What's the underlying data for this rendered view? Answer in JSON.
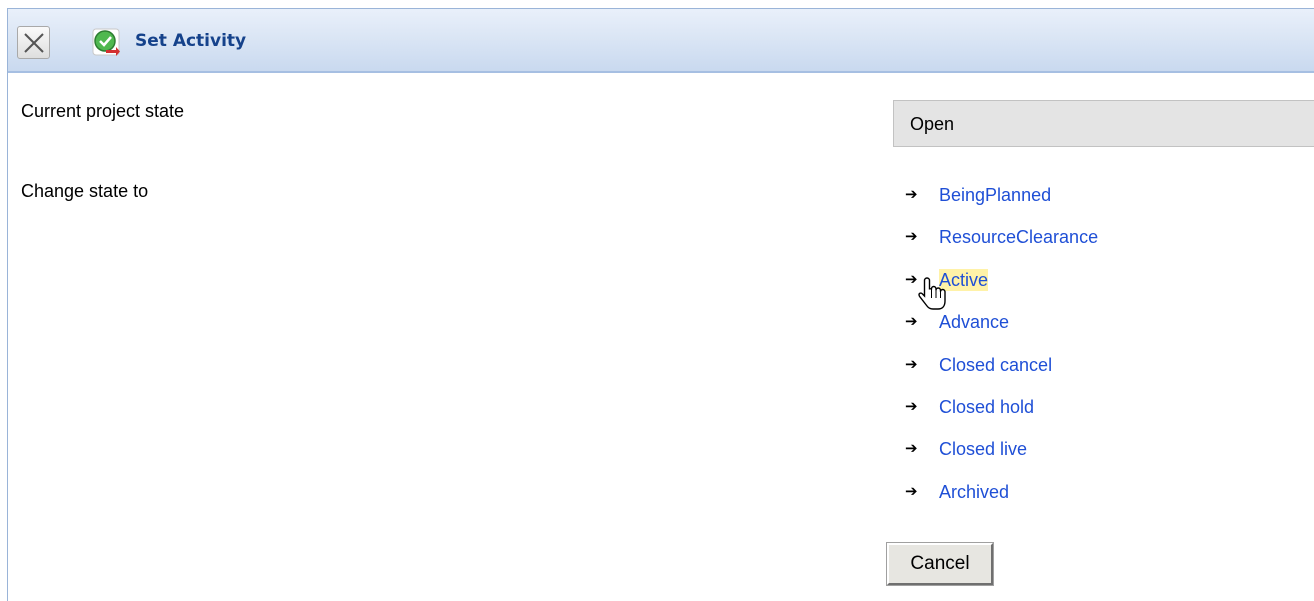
{
  "window": {
    "title": "Set Activity",
    "close_icon": "close-icon",
    "app_icon": "set-activity-icon"
  },
  "form": {
    "current_state_label": "Current project state",
    "current_state_value": "Open",
    "change_state_label": "Change state to",
    "states": [
      {
        "label": "BeingPlanned",
        "hovered": false
      },
      {
        "label": "ResourceClearance",
        "hovered": false
      },
      {
        "label": "Active",
        "hovered": true
      },
      {
        "label": "Advance",
        "hovered": false
      },
      {
        "label": "Closed cancel",
        "hovered": false
      },
      {
        "label": "Closed hold",
        "hovered": false
      },
      {
        "label": "Closed live",
        "hovered": false
      },
      {
        "label": "Archived",
        "hovered": false
      }
    ],
    "arrow_glyph": "➔",
    "cancel_label": "Cancel"
  },
  "colors": {
    "title_text": "#15428b",
    "link": "#1f4fd6",
    "link_hover_bg": "#fff2a8",
    "state_box_bg": "#e4e4e4"
  }
}
